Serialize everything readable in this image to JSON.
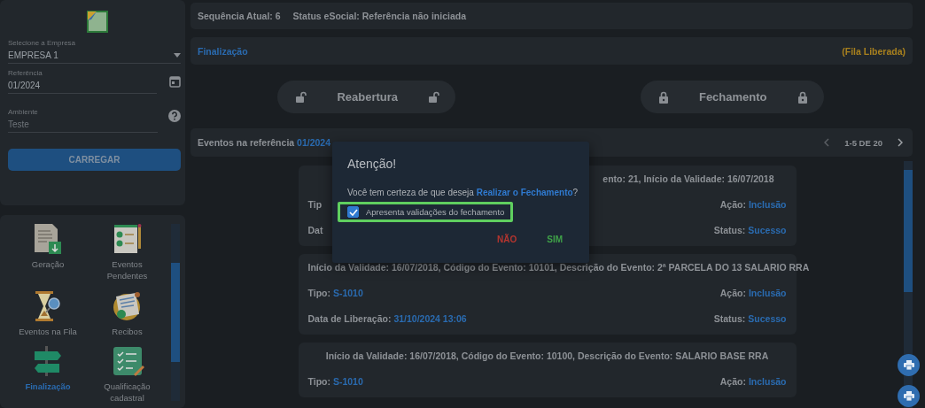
{
  "sidebar": {
    "fields": [
      {
        "kind": "select",
        "label": "Selecione a Empresa",
        "value": "EMPRESA 1"
      },
      {
        "kind": "date",
        "label": "Referência",
        "value": "01/2024"
      },
      {
        "kind": "help",
        "label": "Ambiente",
        "value": "Teste"
      }
    ],
    "load_button": "CARREGAR",
    "menu": [
      {
        "kind": "download",
        "label": "Geração",
        "selected": false
      },
      {
        "kind": "checklist",
        "label": "Eventos Pendentes",
        "selected": false
      },
      {
        "kind": "hourglass",
        "label": "Eventos na Fila",
        "selected": false
      },
      {
        "kind": "receipt",
        "label": "Recibos",
        "selected": false
      },
      {
        "kind": "signpost",
        "label": "Finalização",
        "selected": true
      },
      {
        "kind": "clipboard",
        "label": "Qualificação cadastral",
        "selected": false
      }
    ]
  },
  "status_bar": {
    "sequence": "Sequência Atual: 6",
    "status": "Status eSocial: Referência não iniciada"
  },
  "section": {
    "title": "Finalização",
    "queue": "(Fila Liberada)"
  },
  "actions": [
    {
      "kind": "unlocked",
      "label": "Reabertura"
    },
    {
      "kind": "locked",
      "label": "Fechamento"
    }
  ],
  "events": {
    "title": "Eventos na referência",
    "reference": "01/2024",
    "pagination": "1-5 DE 20",
    "cards": [
      {
        "title": "ento: 21, Início da Validade: 16/07/2018",
        "partial": true,
        "rows": [
          {
            "left": {
              "label": "Tip"
            },
            "right": {
              "label": "Ação:",
              "value": "Inclusão"
            }
          },
          {
            "left": {
              "label": "Dat"
            },
            "right": {
              "label": "Status:",
              "value": "Sucesso"
            }
          }
        ]
      },
      {
        "title": "Início da Validade: 16/07/2018, Código do Evento: 10101, Descrição do Evento: 2ª PARCELA DO 13 SALARIO RRA",
        "rows": [
          {
            "left": {
              "label": "Tipo:",
              "value": "S-1010"
            },
            "right": {
              "label": "Ação:",
              "value": "Inclusão"
            }
          },
          {
            "left": {
              "label": "Data de Liberação:",
              "value": "31/10/2024 13:06"
            },
            "right": {
              "label": "Status:",
              "value": "Sucesso"
            }
          }
        ]
      },
      {
        "title": "Início da Validade: 16/07/2018, Código do Evento: 10100, Descrição do Evento: SALARIO BASE RRA",
        "rows": [
          {
            "left": {
              "label": "Tipo:",
              "value": "S-1010"
            },
            "right": {
              "label": "Ação:",
              "value": "Inclusão"
            }
          }
        ]
      }
    ]
  },
  "dialog": {
    "title": "Atenção!",
    "message": "Você tem certeza de que deseja ",
    "action": "Realizar o Fechamento",
    "message_end": "?",
    "checkbox": {
      "label": "Apresenta validações do fechamento",
      "checked": true,
      "highlighted": true
    },
    "buttons": [
      {
        "kind": "cancel",
        "label": "NÃO"
      },
      {
        "kind": "confirm",
        "label": "SIM"
      }
    ]
  }
}
